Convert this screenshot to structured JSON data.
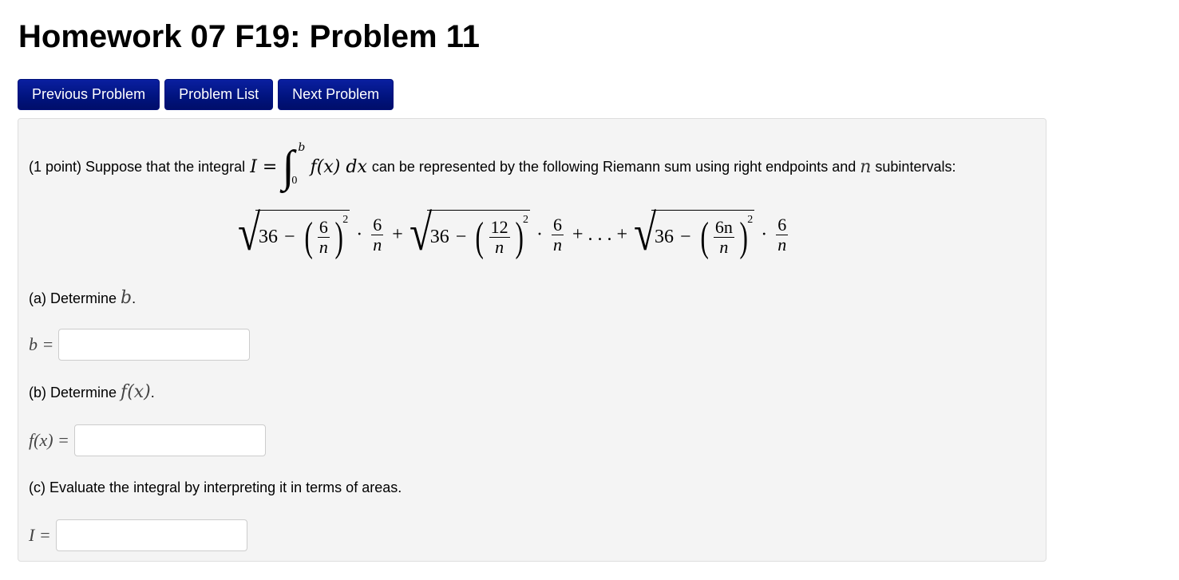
{
  "page": {
    "title": "Homework 07 F19: Problem 11"
  },
  "nav": {
    "previous": "Previous Problem",
    "list": "Problem List",
    "next": "Next Problem"
  },
  "problem": {
    "intro_prefix": "(1 point) Suppose that the integral",
    "integral_lhs": "I =",
    "integral_upper": "b",
    "integral_lower": "0",
    "integrand": "f(x) dx",
    "intro_middle": "can be represented by the following Riemann sum using right endpoints and",
    "n_symbol": "n",
    "intro_suffix": "subintervals:",
    "riemann_sum": {
      "terms": [
        {
          "constant": "36",
          "minus": "−",
          "num": "6",
          "den": "n",
          "exp": "2",
          "dx_num": "6",
          "dx_den": "n"
        },
        {
          "constant": "36",
          "minus": "−",
          "num": "12",
          "den": "n",
          "exp": "2",
          "dx_num": "6",
          "dx_den": "n"
        },
        {
          "constant": "36",
          "minus": "−",
          "num": "6n",
          "den": "n",
          "exp": "2",
          "dx_num": "6",
          "dx_den": "n"
        }
      ],
      "plus": "+",
      "ellipsis": "+ . . . +",
      "dot": "·"
    },
    "parts": {
      "a": {
        "label": "(a) Determine",
        "var": "b",
        "period": ".",
        "lhs": "b =",
        "value": "",
        "placeholder": ""
      },
      "b": {
        "label": "(b) Determine",
        "var": "f(x)",
        "period": ".",
        "lhs": "f(x) =",
        "value": "",
        "placeholder": ""
      },
      "c": {
        "label": "(c) Evaluate the integral by interpreting it in terms of areas.",
        "lhs": "I =",
        "value": "",
        "placeholder": ""
      }
    }
  }
}
